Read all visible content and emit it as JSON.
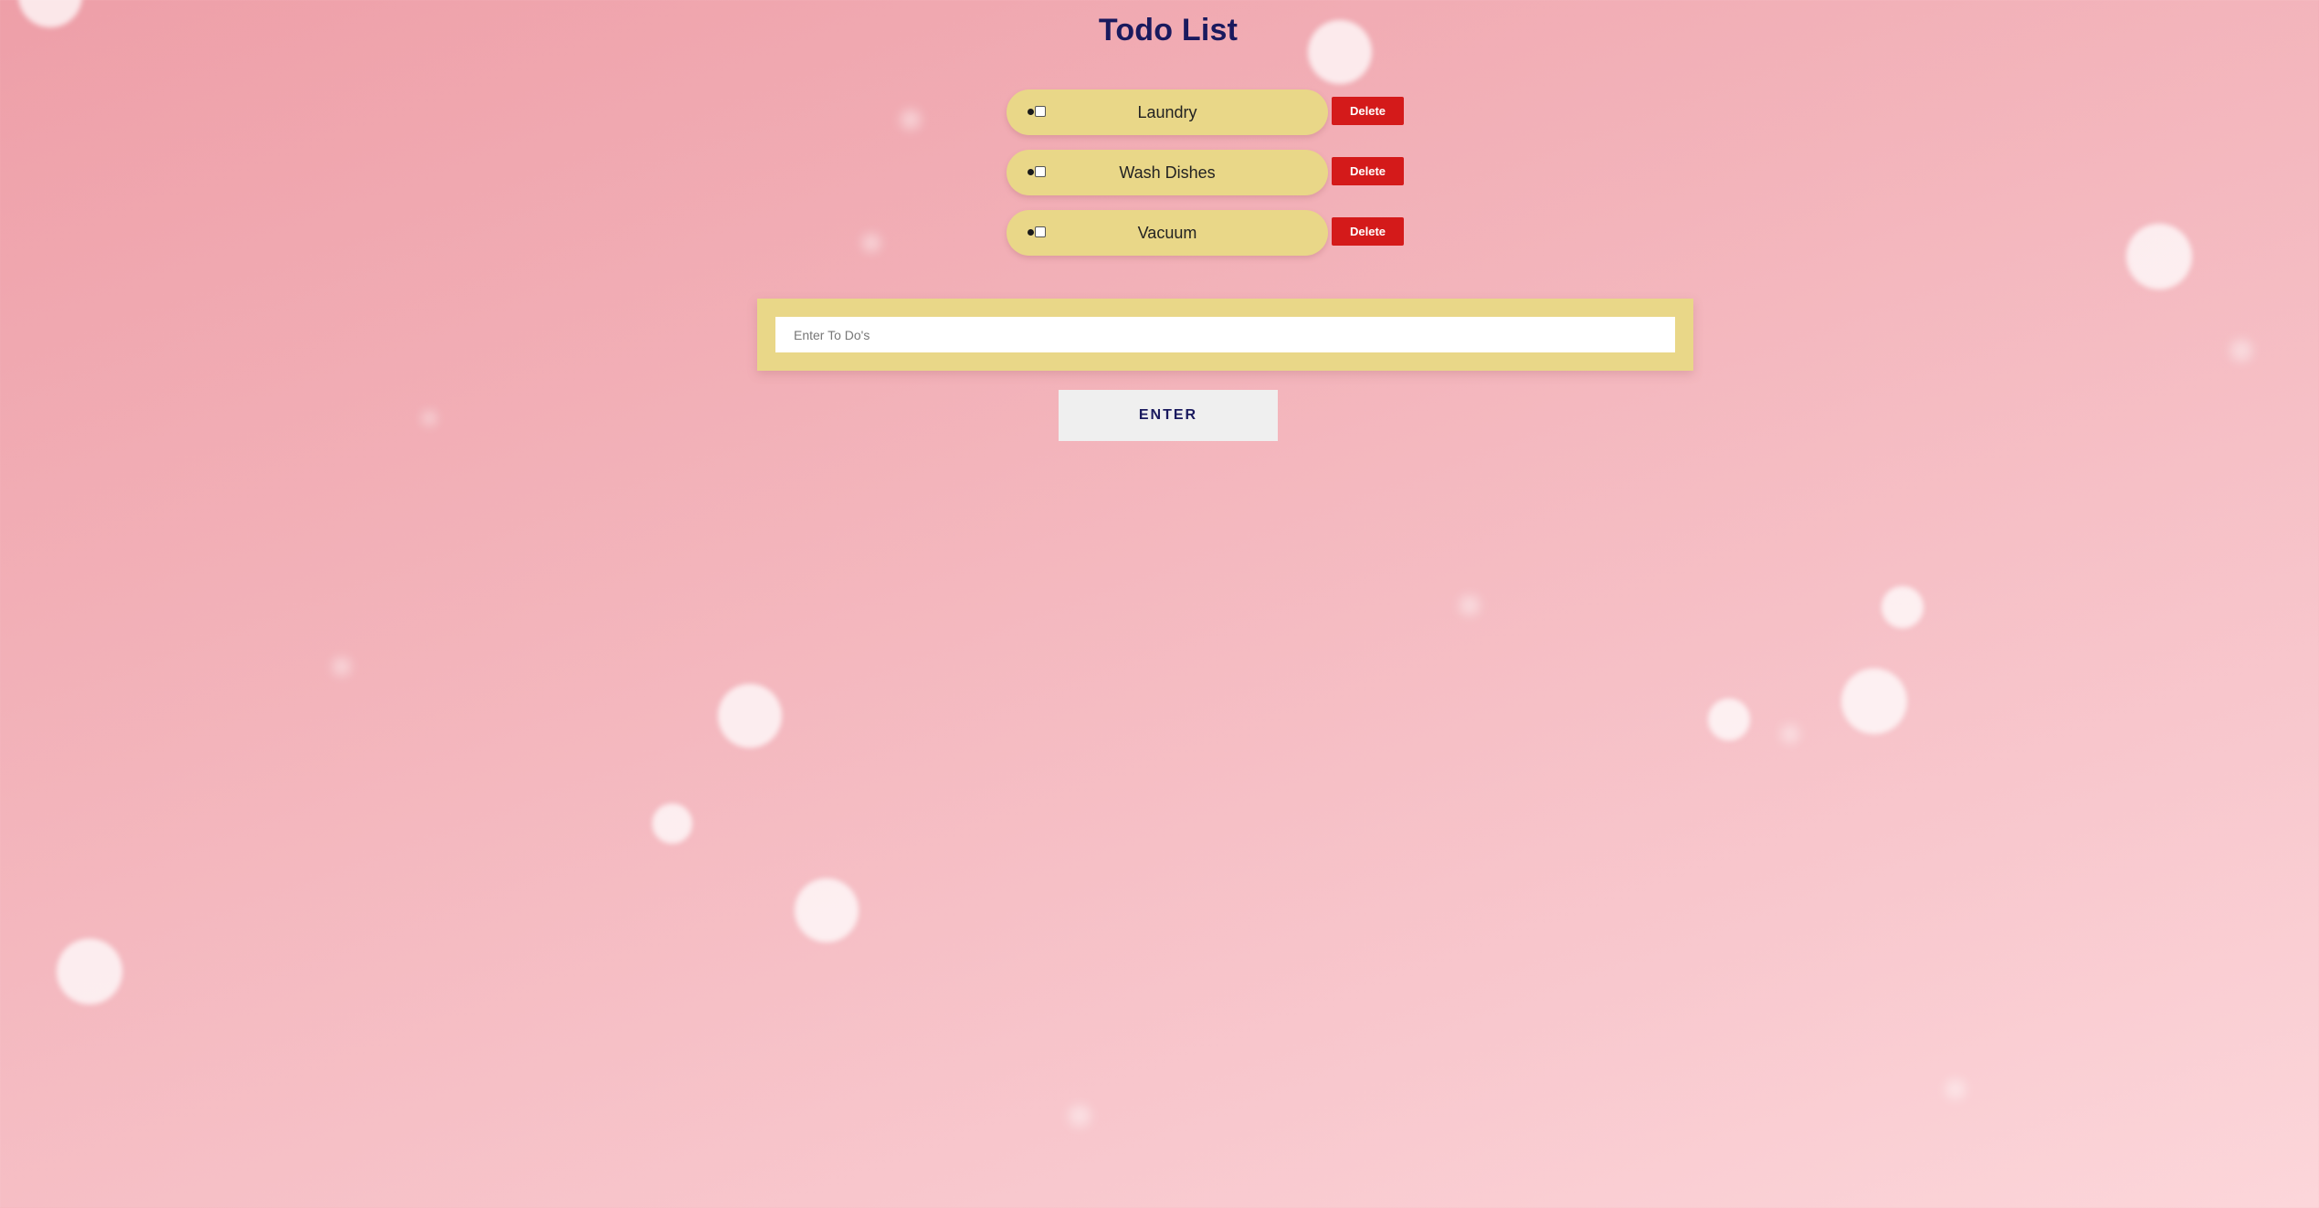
{
  "app": {
    "title": "Todo List"
  },
  "todos": [
    {
      "label": "Laundry",
      "checked": false,
      "delete_label": "Delete"
    },
    {
      "label": "Wash Dishes",
      "checked": false,
      "delete_label": "Delete"
    },
    {
      "label": "Vacuum",
      "checked": false,
      "delete_label": "Delete"
    }
  ],
  "form": {
    "input_value": "",
    "input_placeholder": "Enter To Do's",
    "submit_label": "ENTER"
  },
  "colors": {
    "background_start": "#ee9fa8",
    "background_end": "#fcd6da",
    "pill": "#e9d788",
    "delete_button": "#d41a1a",
    "title": "#1a1a5e",
    "enter_button": "#efefef"
  }
}
